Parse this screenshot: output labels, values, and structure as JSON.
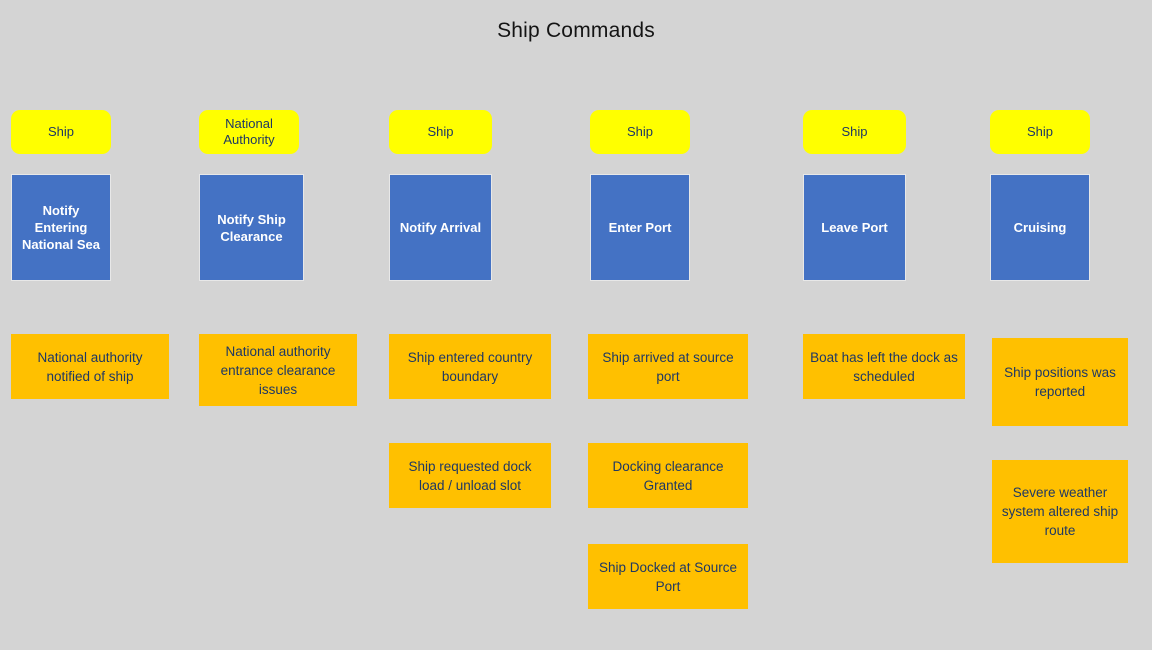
{
  "title": "Ship Commands",
  "colors": {
    "background": "#d4d4d4",
    "actor": "#ffff00",
    "command": "#4472c4",
    "event": "#ffc000",
    "dark_text": "#1f3864",
    "light_text": "#ffffff"
  },
  "columns": [
    {
      "actor": "Ship",
      "command": "Notify Entering National Sea",
      "events": [
        "National authority notified of ship"
      ]
    },
    {
      "actor": "National Authority",
      "command": "Notify Ship Clearance",
      "events": [
        "National authority entrance clearance issues"
      ]
    },
    {
      "actor": "Ship",
      "command": "Notify Arrival",
      "events": [
        "Ship entered country boundary",
        "Ship requested dock load / unload slot"
      ]
    },
    {
      "actor": "Ship",
      "command": "Enter Port",
      "events": [
        "Ship arrived at source port",
        "Docking clearance Granted",
        "Ship Docked at Source Port"
      ]
    },
    {
      "actor": "Ship",
      "command": "Leave Port",
      "events": [
        "Boat has left the dock as scheduled"
      ]
    },
    {
      "actor": "Ship",
      "command": "Cruising",
      "events": [
        "Ship positions was reported",
        "Severe weather system altered ship route"
      ]
    }
  ]
}
